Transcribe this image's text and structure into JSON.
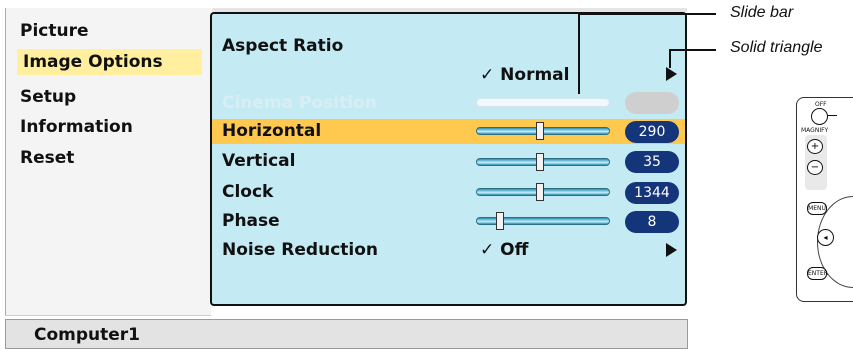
{
  "sidebar": {
    "items": [
      {
        "label": "Picture",
        "active": false
      },
      {
        "label": "Image Options",
        "active": true
      },
      {
        "label": "Setup",
        "active": false
      },
      {
        "label": "Information",
        "active": false
      },
      {
        "label": "Reset",
        "active": false
      }
    ]
  },
  "panel": {
    "aspect_ratio": {
      "label": "Aspect Ratio",
      "value": "✓ Normal"
    },
    "cinema_position": {
      "label": "Cinema Position",
      "enabled": false
    },
    "rows": [
      {
        "label": "Horizontal",
        "value": "290",
        "level": 0.45,
        "highlighted": true
      },
      {
        "label": "Vertical",
        "value": "35",
        "level": 0.45,
        "highlighted": false
      },
      {
        "label": "Clock",
        "value": "1344",
        "level": 0.45,
        "highlighted": false
      },
      {
        "label": "Phase",
        "value": "8",
        "level": 0.15,
        "highlighted": false
      }
    ],
    "noise_reduction": {
      "label": "Noise Reduction",
      "value": "✓ Off"
    }
  },
  "status_bar": {
    "source": "Computer1"
  },
  "callouts": {
    "slide_bar": "Slide bar",
    "solid_triangle": "Solid triangle"
  },
  "remote": {
    "labels": {
      "off": "OFF",
      "magnify": "MAGNIFY",
      "plus": "+",
      "minus": "−",
      "menu": "MENU",
      "enter": "ENTER"
    }
  },
  "colors": {
    "panel_bg": "#c4eaf4",
    "sidebar_active": "#ffef9e",
    "row_highlight": "#ffc94f",
    "value_pill": "#14357a"
  }
}
